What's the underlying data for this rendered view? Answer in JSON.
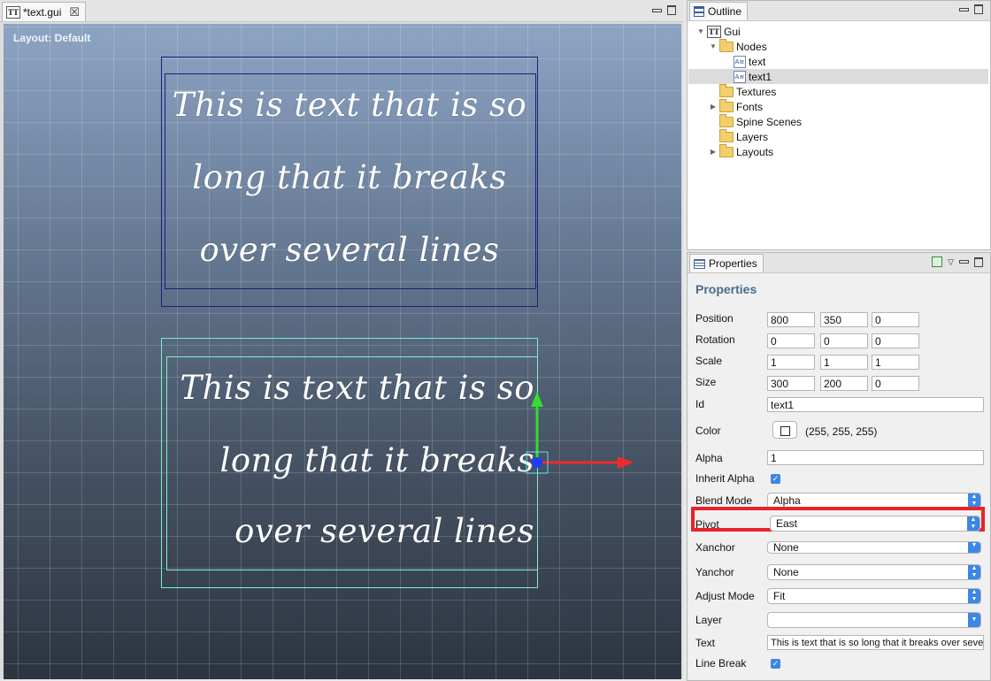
{
  "editor": {
    "tab_label": "*text.gui",
    "tab_icon": "TT",
    "layout_label": "Layout: Default",
    "nodes": [
      {
        "name": "text",
        "lines": [
          "This is text that is so",
          "long that it breaks",
          "over several lines"
        ]
      },
      {
        "name": "text1",
        "lines": [
          "This is text that is so",
          "long that it breaks",
          "over several lines"
        ]
      }
    ]
  },
  "outline": {
    "tab_label": "Outline",
    "tree": {
      "gui": "Gui",
      "nodes": "Nodes",
      "text": "text",
      "text1": "text1",
      "textures": "Textures",
      "fonts": "Fonts",
      "spine_scenes": "Spine Scenes",
      "layers": "Layers",
      "layouts": "Layouts"
    }
  },
  "properties": {
    "tab_label": "Properties",
    "heading": "Properties",
    "position": {
      "label": "Position",
      "x": "800",
      "y": "350",
      "z": "0"
    },
    "rotation": {
      "label": "Rotation",
      "x": "0",
      "y": "0",
      "z": "0"
    },
    "scale": {
      "label": "Scale",
      "x": "1",
      "y": "1",
      "z": "1"
    },
    "size": {
      "label": "Size",
      "x": "300",
      "y": "200",
      "z": "0"
    },
    "id": {
      "label": "Id",
      "value": "text1"
    },
    "color": {
      "label": "Color",
      "value": "(255, 255, 255)"
    },
    "alpha": {
      "label": "Alpha",
      "value": "1"
    },
    "inherit_alpha": {
      "label": "Inherit Alpha",
      "checked": true
    },
    "blend_mode": {
      "label": "Blend Mode",
      "value": "Alpha"
    },
    "pivot": {
      "label": "Pivot",
      "value": "East"
    },
    "xanchor": {
      "label": "Xanchor",
      "value": "None"
    },
    "yanchor": {
      "label": "Yanchor",
      "value": "None"
    },
    "adjust_mode": {
      "label": "Adjust Mode",
      "value": "Fit"
    },
    "layer": {
      "label": "Layer",
      "value": ""
    },
    "text": {
      "label": "Text",
      "value": "This is text that is so long that it breaks over several lines"
    },
    "line_break": {
      "label": "Line Break",
      "checked": true
    }
  },
  "colors": {
    "highlight": "#e8232a",
    "accent": "#3b87e6",
    "selection": "#7ff0cc",
    "node_outline": "#1c1f7a"
  }
}
